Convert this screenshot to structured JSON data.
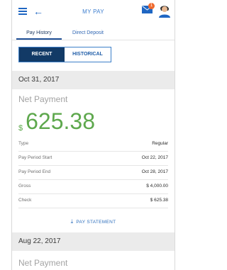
{
  "header": {
    "title": "MY PAY",
    "notification_count": "1"
  },
  "tabs": [
    {
      "label": "Pay History",
      "active": true
    },
    {
      "label": "Direct Deposit",
      "active": false
    }
  ],
  "toggle": {
    "recent": "RECENT",
    "historical": "HISTORICAL",
    "selected": "RECENT"
  },
  "payments": [
    {
      "date": "Oct 31, 2017",
      "net_label": "Net Payment",
      "currency": "$",
      "amount": "625.38",
      "details": [
        {
          "label": "Type",
          "value": "Regular"
        },
        {
          "label": "Pay Period Start",
          "value": "Oct 22, 2017"
        },
        {
          "label": "Pay Period End",
          "value": "Oct 28, 2017"
        },
        {
          "label": "Gross",
          "value": "$ 4,000.00"
        },
        {
          "label": "Check",
          "value": "$ 625.38"
        }
      ],
      "statement_link": "PAY STATEMENT"
    },
    {
      "date": "Aug 22, 2017",
      "net_label": "Net Payment"
    }
  ],
  "colors": {
    "accent": "#1f66c2",
    "amount": "#5ea84d",
    "selected_toggle": "#123a66",
    "badge": "#ef6a2e"
  },
  "icons": [
    "menu-icon",
    "back-arrow-icon",
    "mail-icon",
    "avatar",
    "download-icon"
  ]
}
